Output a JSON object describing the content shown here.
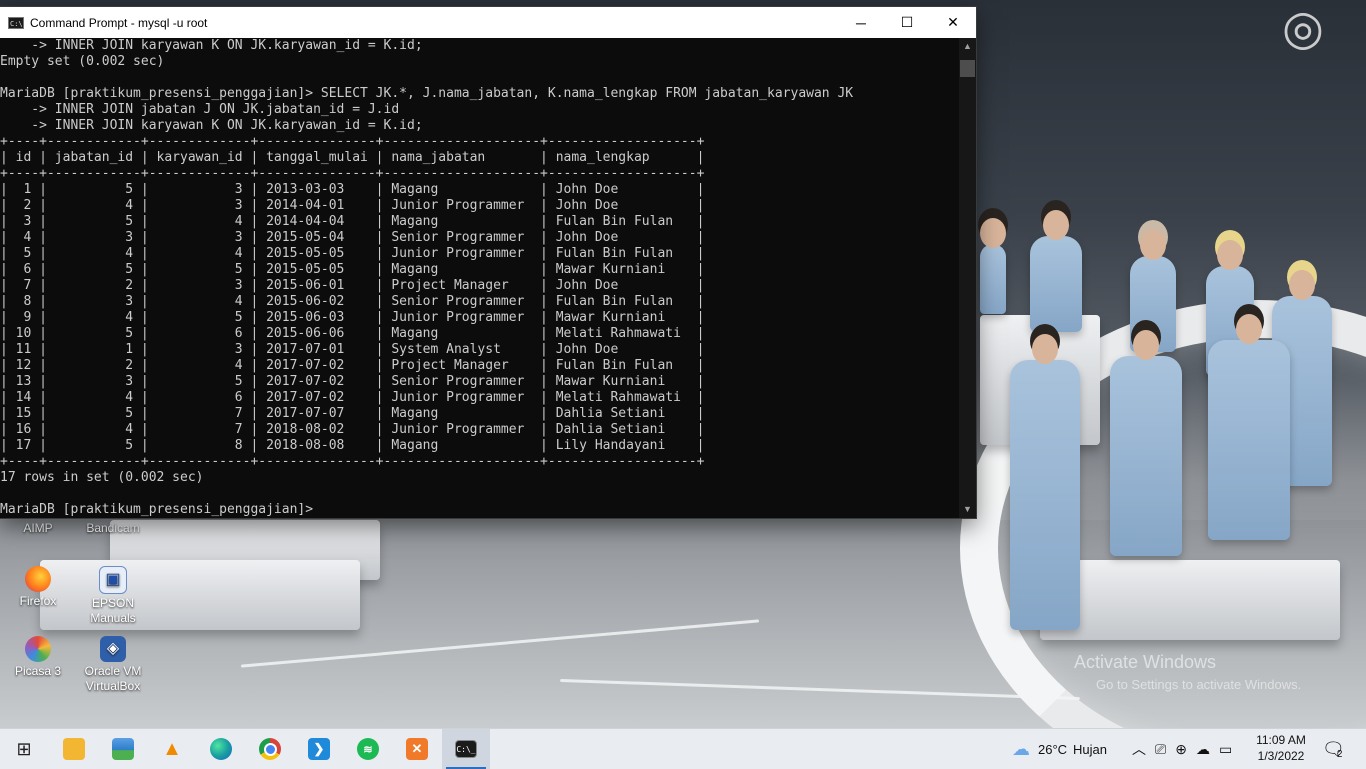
{
  "window": {
    "title": "Command Prompt - mysql  -u root",
    "buttons": {
      "minimize": "─",
      "maximize": "☐",
      "close": "✕"
    }
  },
  "terminal": {
    "lines": [
      "    -> INNER JOIN karyawan K ON JK.karyawan_id = K.id;",
      "Empty set (0.002 sec)",
      "",
      "MariaDB [praktikum_presensi_penggajian]> SELECT JK.*, J.nama_jabatan, K.nama_lengkap FROM jabatan_karyawan JK",
      "    -> INNER JOIN jabatan J ON JK.jabatan_id = J.id",
      "    -> INNER JOIN karyawan K ON JK.karyawan_id = K.id;",
      "+----+------------+-------------+---------------+--------------------+-------------------+",
      "| id | jabatan_id | karyawan_id | tanggal_mulai | nama_jabatan       | nama_lengkap      |",
      "+----+------------+-------------+---------------+--------------------+-------------------+",
      "|  1 |          5 |           3 | 2013-03-03    | Magang             | John Doe          |",
      "|  2 |          4 |           3 | 2014-04-01    | Junior Programmer  | John Doe          |",
      "|  3 |          5 |           4 | 2014-04-04    | Magang             | Fulan Bin Fulan   |",
      "|  4 |          3 |           3 | 2015-05-04    | Senior Programmer  | John Doe          |",
      "|  5 |          4 |           4 | 2015-05-05    | Junior Programmer  | Fulan Bin Fulan   |",
      "|  6 |          5 |           5 | 2015-05-05    | Magang             | Mawar Kurniani    |",
      "|  7 |          2 |           3 | 2015-06-01    | Project Manager    | John Doe          |",
      "|  8 |          3 |           4 | 2015-06-02    | Senior Programmer  | Fulan Bin Fulan   |",
      "|  9 |          4 |           5 | 2015-06-03    | Junior Programmer  | Mawar Kurniani    |",
      "| 10 |          5 |           6 | 2015-06-06    | Magang             | Melati Rahmawati  |",
      "| 11 |          1 |           3 | 2017-07-01    | System Analyst     | John Doe          |",
      "| 12 |          2 |           4 | 2017-07-02    | Project Manager    | Fulan Bin Fulan   |",
      "| 13 |          3 |           5 | 2017-07-02    | Senior Programmer  | Mawar Kurniani    |",
      "| 14 |          4 |           6 | 2017-07-02    | Junior Programmer  | Melati Rahmawati  |",
      "| 15 |          5 |           7 | 2017-07-07    | Magang             | Dahlia Setiani    |",
      "| 16 |          4 |           7 | 2018-08-02    | Junior Programmer  | Dahlia Setiani    |",
      "| 17 |          5 |           8 | 2018-08-08    | Magang             | Lily Handayani    |",
      "+----+------------+-------------+---------------+--------------------+-------------------+",
      "17 rows in set (0.002 sec)",
      "",
      "MariaDB [praktikum_presensi_penggajian]>"
    ]
  },
  "desktop": {
    "icons": [
      {
        "label": "AIMP",
        "icon": "aimp-icon"
      },
      {
        "label": "Bandicam",
        "icon": "bandicam-icon"
      },
      {
        "label": "Firefox",
        "icon": "firefox-icon"
      },
      {
        "label": "EPSON Manuals",
        "icon": "epson-manuals-icon"
      },
      {
        "label": "Picasa 3",
        "icon": "picasa-icon"
      },
      {
        "label": "Oracle VM VirtualBox",
        "icon": "virtualbox-icon"
      }
    ],
    "watermark": {
      "line1": "Activate Windows",
      "line2": "Go to Settings to activate Windows."
    }
  },
  "taskbar": {
    "apps": [
      {
        "name": "start",
        "icon": "windows-start-icon",
        "color": "#1f1f1f"
      },
      {
        "name": "file-explorer",
        "icon": "folder-icon",
        "color": "#f2b632"
      },
      {
        "name": "photos",
        "icon": "photos-icon",
        "color": "#2d7dc8"
      },
      {
        "name": "vlc",
        "icon": "vlc-icon",
        "color": "#f08a00"
      },
      {
        "name": "edge",
        "icon": "edge-icon",
        "color": "#1aa0a0"
      },
      {
        "name": "chrome",
        "icon": "chrome-icon",
        "color": "#d9443a"
      },
      {
        "name": "vscode",
        "icon": "vscode-icon",
        "color": "#1f8ad9"
      },
      {
        "name": "spotify",
        "icon": "spotify-icon",
        "color": "#1db954"
      },
      {
        "name": "xampp",
        "icon": "xampp-icon",
        "color": "#f07a2a"
      },
      {
        "name": "command-prompt",
        "icon": "cmd-icon",
        "color": "#1b1b1b"
      }
    ],
    "weather": {
      "temp": "26°C",
      "condition": "Hujan"
    },
    "clock": {
      "time": "11:09 AM",
      "date": "1/3/2022"
    },
    "notifications": "2"
  }
}
